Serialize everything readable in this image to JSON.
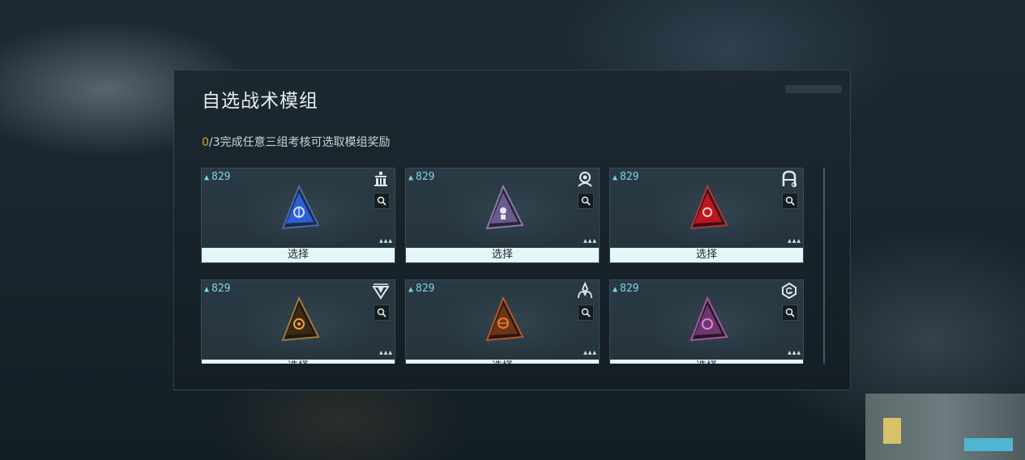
{
  "panel": {
    "title": "自选战术模组",
    "progress_current": "0",
    "progress_rest": "/3完成任意三组考核可选取模组奖励"
  },
  "cards": [
    {
      "count": "829",
      "select_label": "选择",
      "type_icon": "balance-icon",
      "module_color": "#2c5fd6",
      "accent": "#7fa4ff"
    },
    {
      "count": "829",
      "select_label": "选择",
      "type_icon": "helmet-icon",
      "module_color": "#6a5b8e",
      "accent": "#d8c9ff"
    },
    {
      "count": "829",
      "select_label": "选择",
      "type_icon": "shield-a-icon",
      "module_color": "#c0161f",
      "accent": "#ff6666"
    },
    {
      "count": "829",
      "select_label": "选择",
      "type_icon": "diamond-icon",
      "module_color": "#3a2a16",
      "accent": "#f2a13a"
    },
    {
      "count": "829",
      "select_label": "选择",
      "type_icon": "flame-icon",
      "module_color": "#6a3616",
      "accent": "#f07a2a"
    },
    {
      "count": "829",
      "select_label": "选择",
      "type_icon": "hex-g-icon",
      "module_color": "#6a3a6a",
      "accent": "#f07ae0"
    }
  ],
  "colors": {
    "accent_count": "#7ed3e6",
    "progress_highlight": "#e0a13a",
    "select_button_bg": "#e3f6f8"
  }
}
